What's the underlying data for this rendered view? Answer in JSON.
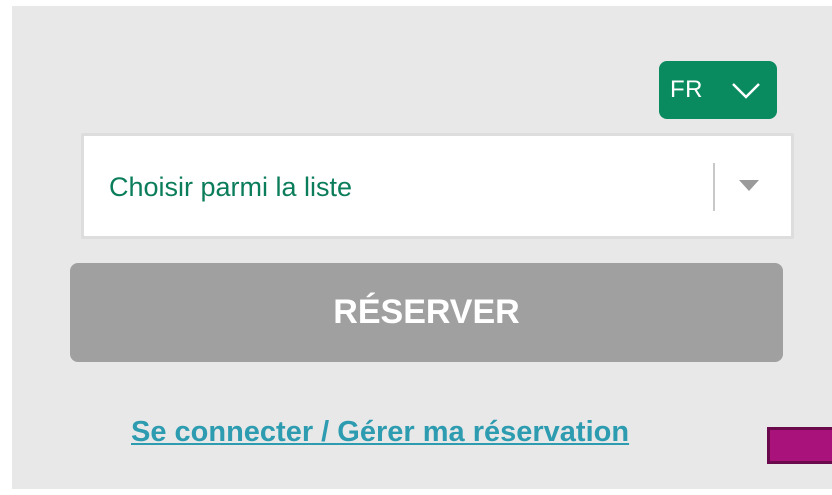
{
  "language_selector": {
    "label": "FR",
    "icon": "chevron-down-icon",
    "color": "#0a8a5f"
  },
  "select": {
    "value": "Choisir parmi la liste",
    "icon": "caret-down-icon",
    "text_color": "#0b7d5b"
  },
  "reserve_button": {
    "label": "RÉSERVER",
    "state": "disabled",
    "color": "#a0a0a0"
  },
  "login_link": {
    "label": "Se connecter / Gérer ma réservation",
    "color": "#2d9cb0"
  },
  "colors": {
    "panel_background": "#e8e8e8",
    "accent": "#a8127a"
  }
}
